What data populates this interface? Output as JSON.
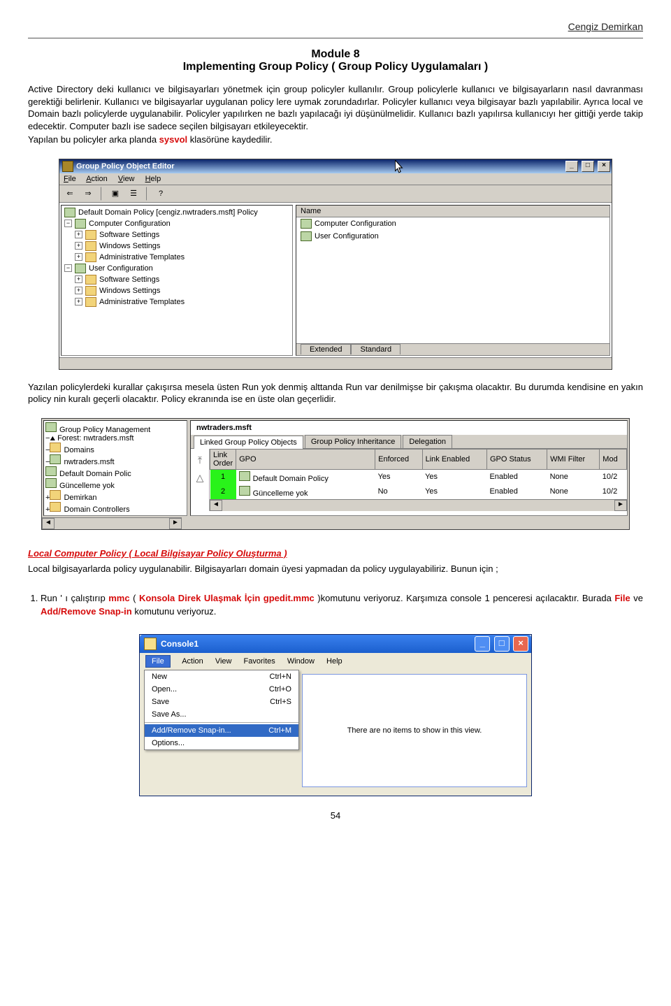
{
  "author": "Cengiz Demirkan",
  "module_no": "Module 8",
  "module_title": "Implementing Group Policy ( Group Policy Uygulamaları )",
  "p1": "Active Directory deki kullanıcı ve bilgisayarları yönetmek için group policyler kullanılır. Group policylerle kullanıcı ve bilgisayarların nasıl davranması gerektiği belirlenir. Kullanıcı ve bilgisayarlar uygulanan policy lere uymak zorundadırlar. Policyler kullanıcı veya bilgisayar bazlı yapılabilir. Ayrıca local ve Domain bazlı policylerde uygulanabilir. Policyler yapılırken ne bazlı yapılacağı iyi düşünülmelidir. Kullanıcı bazlı yapılırsa kullanıcıyı her gittiği yerde takip edecektir. Computer bazlı ise sadece seçilen bilgisayarı etkileyecektir.",
  "p1_tail_pre": "Yapılan bu policyler arka planda ",
  "p1_sysvol": "sysvol",
  "p1_tail_post": " klasörüne kaydedilir.",
  "gpo_editor": {
    "title": "Group Policy Object Editor",
    "menus": {
      "file": "File",
      "action": "Action",
      "view": "View",
      "help": "Help"
    },
    "tree_root": "Default Domain Policy [cengiz.nwtraders.msft] Policy",
    "cc": "Computer Configuration",
    "uc": "User Configuration",
    "ss": "Software Settings",
    "ws": "Windows Settings",
    "at": "Administrative Templates",
    "list_header": "Name",
    "list_cc": "Computer Configuration",
    "list_uc": "User Configuration",
    "tab_ext": "Extended",
    "tab_std": "Standard"
  },
  "p2": "Yazılan policylerdeki kurallar çakışırsa mesela üsten Run yok denmiş alttanda Run var denilmişse bir çakışma olacaktır. Bu durumda kendisine en yakın policy nin kuralı geçerli olacaktır. Policy ekranında ise en üste olan geçerlidir.",
  "gpm": {
    "root": "Group Policy Management",
    "forest": "Forest: nwtraders.msft",
    "domains": "Domains",
    "domain": "nwtraders.msft",
    "ddp": "Default Domain Polic",
    "gy": "Güncelleme yok",
    "dem": "Demirkan",
    "dc": "Domain Controllers",
    "title": "nwtraders.msft",
    "tabs": {
      "l": "Linked Group Policy Objects",
      "i": "Group Policy Inheritance",
      "d": "Delegation"
    },
    "cols": {
      "lo": "Link Order",
      "gpo": "GPO",
      "enf": "Enforced",
      "le": "Link Enabled",
      "gs": "GPO Status",
      "wf": "WMI Filter",
      "mod": "Mod"
    },
    "rows": [
      {
        "lo": "1",
        "gpo": "Default Domain Policy",
        "enf": "Yes",
        "le": "Yes",
        "gs": "Enabled",
        "wf": "None",
        "mod": "10/2"
      },
      {
        "lo": "2",
        "gpo": "Güncelleme yok",
        "enf": "No",
        "le": "Yes",
        "gs": "Enabled",
        "wf": "None",
        "mod": "10/2"
      }
    ]
  },
  "h_local": "Local Computer Policy ( Local Bilgisayar Policy Oluşturma )",
  "p3": "Local bilgisayarlarda policy uygulanabilir. Bilgisayarları domain üyesi yapmadan da policy uygulayabiliriz. Bunun için ;",
  "li1_a": "Run ' ı çalıştırıp ",
  "li1_mmc": "mmc",
  "li1_b": " ( ",
  "li1_k": "Konsola Direk Ulaşmak İçin gpedit.mmc",
  "li1_c": " )komutunu veriyoruz. Karşımıza console 1  penceresi açılacaktır. Burada ",
  "li1_file": "File",
  "li1_d": " ve ",
  "li1_add": "Add/Remove Snap-in",
  "li1_e": " komutunu veriyoruz.",
  "console": {
    "title": "Console1",
    "menus": {
      "file": "File",
      "action": "Action",
      "view": "View",
      "fav": "Favorites",
      "win": "Window",
      "help": "Help"
    },
    "items": [
      {
        "l": "New",
        "s": "Ctrl+N"
      },
      {
        "l": "Open...",
        "s": "Ctrl+O"
      },
      {
        "l": "Save",
        "s": "Ctrl+S"
      },
      {
        "l": "Save As...",
        "s": ""
      },
      {
        "l": "Add/Remove Snap-in...",
        "s": "Ctrl+M"
      },
      {
        "l": "Options...",
        "s": ""
      }
    ],
    "empty": "There are no items to show in this view."
  },
  "page_num": "54"
}
